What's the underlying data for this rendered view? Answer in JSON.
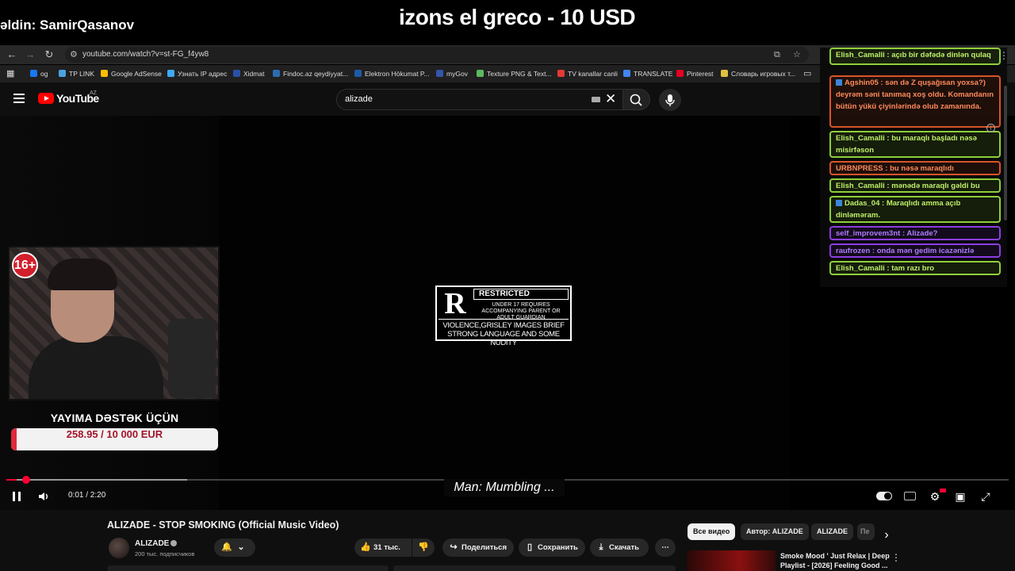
{
  "overlay": {
    "donor_line": "əldin: SamirQasanov",
    "ticker": "izons el greco - 10 USD"
  },
  "browser": {
    "url": "youtube.com/watch?v=st-FG_f4yw8",
    "bookmarks": [
      {
        "label": "og",
        "color": "#1877f2"
      },
      {
        "label": "TP LINK",
        "color": "#4aa3df"
      },
      {
        "label": "Google AdSense",
        "color": "#fbbc04"
      },
      {
        "label": "Узнать IP адрес",
        "color": "#3fa9f5"
      },
      {
        "label": "Xidmat",
        "color": "#2b4fa8"
      },
      {
        "label": "Findoc.az qeydiyyat...",
        "color": "#2b6cb0"
      },
      {
        "label": "Elektron Hökumat P...",
        "color": "#1e5aa8"
      },
      {
        "label": "myGov",
        "color": "#3355aa"
      },
      {
        "label": "Texture PNG & Text...",
        "color": "#5cb85c"
      },
      {
        "label": "TV kanallar canli",
        "color": "#e53935"
      },
      {
        "label": "TRANSLATE",
        "color": "#4285f4"
      },
      {
        "label": "Pinterest",
        "color": "#e60023"
      },
      {
        "label": "Словарь игровых т...",
        "color": "#e0c040"
      }
    ]
  },
  "youtube": {
    "brand": "YouTube",
    "region": "AZ",
    "search_value": "alizade"
  },
  "rating_card": {
    "letter": "R",
    "title": "RESTRICTED",
    "subtitle": "UNDER 17 REQUIRES ACCOMPANYING PARENT OR ADULT GUARDIAN",
    "reason": "VIOLENCE,GRISLEY IMAGES BRIEF STRONG LANGUAGE AND SOME NUDITY"
  },
  "stream": {
    "age_badge": "16+",
    "support_label": "YAYIMA DƏSTƏK ÜÇÜN",
    "goal_text": "258.95 / 10 000 EUR",
    "goal_fraction": 0.026
  },
  "chat": [
    {
      "user": "Elish_Camalli",
      "text": "açıb bir dəfədə dinlən qulaq asmaram bunada",
      "style": "green",
      "icon": false
    },
    {
      "user": "Agshin05",
      "text": "sən də Z quşağısan yoxsa?) deyrəm səni tanımaq xoş oldu. Komandanın bütün yükü çiyinlərində olub zamanında.",
      "style": "red",
      "icon": true
    },
    {
      "user": "Elish_Camalli",
      "text": "bu maraqlı başladı nəsə misirfəson",
      "style": "green",
      "icon": false
    },
    {
      "user": "URBNPRESS",
      "text": "bu nəsə maraqlıdı",
      "style": "red",
      "icon": false
    },
    {
      "user": "Elish_Camalli",
      "text": "mənədə maraqlı gəldi bu",
      "style": "green",
      "icon": false
    },
    {
      "user": "Dadas_04",
      "text": "Maraqlıdı amma açıb dinləməram.",
      "style": "green",
      "icon": true
    },
    {
      "user": "self_improvem3nt",
      "text": "Alizade?",
      "style": "purple",
      "icon": false
    },
    {
      "user": "raufrozen",
      "text": "onda mən gedim icazənizlə",
      "style": "purple",
      "icon": false
    },
    {
      "user": "Elish_Camalli",
      "text": "tam razı bro",
      "style": "green",
      "icon": false
    }
  ],
  "player": {
    "caption": "Man: Mumbling ...",
    "time": "0:01 / 2:20",
    "played_fraction": 0.01,
    "buffered_fraction": 0.18
  },
  "video": {
    "title": "ALIZADE - STOP SMOKING (Official Music Video)",
    "channel": "ALIZADE",
    "subscribers": "200 тыс. подписчиков",
    "likes": "31 тыс.",
    "share_label": "Поделиться",
    "save_label": "Сохранить",
    "download_label": "Скачать"
  },
  "chips": [
    "Все видео",
    "Автор: ALIZADE",
    "ALIZADE",
    "Пе"
  ],
  "recommendation": {
    "title": "Smoke Mood ' Just Relax | Deep Playlist - [2026] Feeling Good ..."
  },
  "colors": {
    "youtube_red": "#ff0000",
    "progress_red": "#ff0033",
    "goal_red": "#e0293c"
  }
}
